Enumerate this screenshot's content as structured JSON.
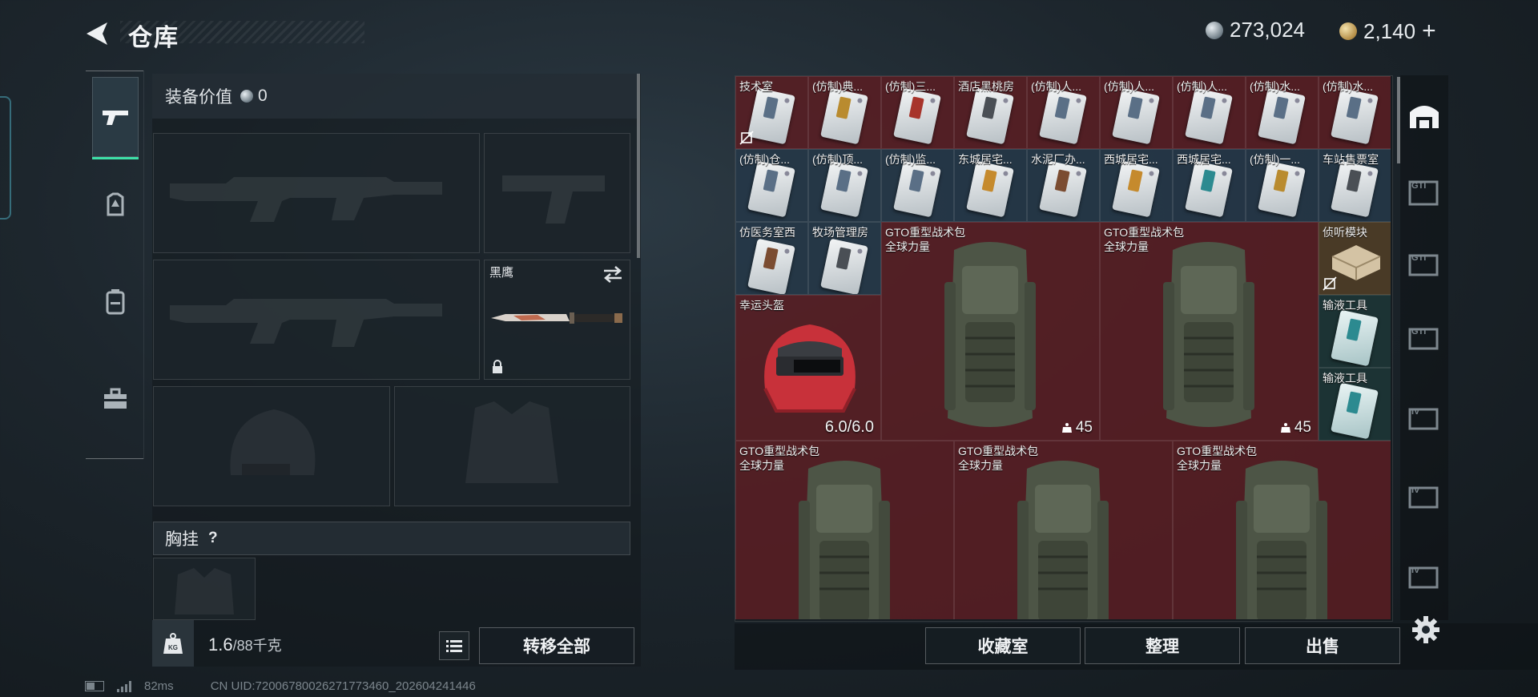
{
  "header": {
    "title": "仓库",
    "currency_silver": "273,024",
    "currency_gold": "2,140",
    "add_symbol": "+"
  },
  "left": {
    "equip_value_label": "装备价值",
    "equip_value": "0",
    "melee_name": "黑鹰",
    "chest_label": "胸挂",
    "chest_help": "?",
    "weight_current": "1.6",
    "weight_max": "/88千克",
    "transfer_all_label": "转移全部",
    "weight_icon_text": "KG"
  },
  "grid": {
    "row1": [
      "技术室",
      "(仿制)典...",
      "(仿制)三...",
      "酒店黑桃房",
      "(仿制)人...",
      "(仿制)人...",
      "(仿制)人...",
      "(仿制)水...",
      "(仿制)水..."
    ],
    "row2": [
      "(仿制)仓...",
      "(仿制)顶...",
      "(仿制)监...",
      "东城居宅...",
      "水泥厂办...",
      "西城居宅...",
      "西城居宅...",
      "(仿制)一...",
      "车站售票室"
    ],
    "row3_a": "仿医务室西",
    "row3_b": "牧场管理房",
    "backpack_name": "GTO重型战术包",
    "backpack_brand": "全球力量",
    "backpack_count": "45",
    "detector_name": "侦听模块",
    "helmet_name": "幸运头盔",
    "helmet_durability": "6.0/6.0",
    "infusion_name": "输液工具"
  },
  "buttons": {
    "collection": "收藏室",
    "sort": "整理",
    "sell": "出售"
  },
  "status": {
    "ping": "82ms",
    "uid": "CN UID:72006780026271773460_202604241446"
  },
  "right_tabs": [
    "GTI",
    "GTI",
    "GTI",
    "IV",
    "IV",
    "IV"
  ],
  "colors": {
    "accent": "#3de0a8",
    "cell_red": "#681e24",
    "cell_blue": "#283c4e"
  }
}
